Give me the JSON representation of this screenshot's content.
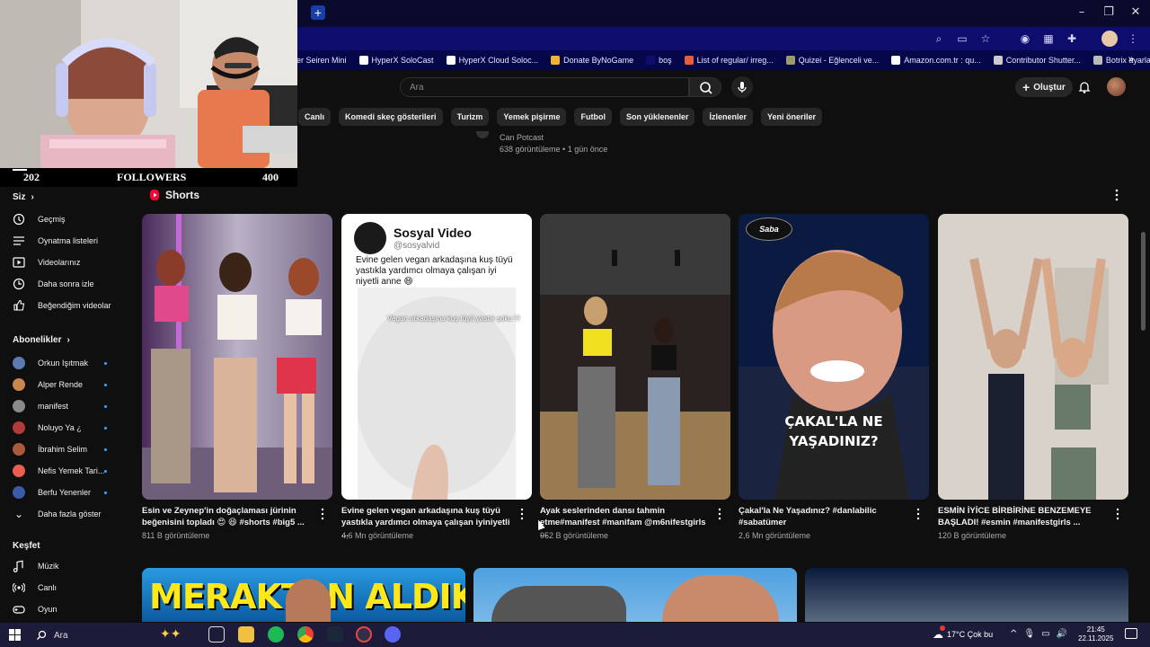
{
  "browser": {
    "bookmarks": [
      {
        "label": "er Seiren Mini",
        "color": "#7a7ab8"
      },
      {
        "label": "HyperX SoloCast",
        "color": "#ffffff"
      },
      {
        "label": "HyperX Cloud Soloc...",
        "color": "#ffffff"
      },
      {
        "label": "Donate ByNoGame",
        "color": "#f2b233"
      },
      {
        "label": "boş",
        "color": "#0d0d6e"
      },
      {
        "label": "List of regular/ irreg...",
        "color": "#e65f3a"
      },
      {
        "label": "Quizei - Eğlenceli ve...",
        "color": "#9c9c6b"
      },
      {
        "label": "Amazon.com.tr : qu...",
        "color": "#ffffff"
      },
      {
        "label": "Contributor  Shutter...",
        "color": "#cccccc"
      },
      {
        "label": "Botrix ayarları nasıl...",
        "color": "#bbbbbb"
      }
    ]
  },
  "header": {
    "search_placeholder": "Ara",
    "create_label": "Oluştur"
  },
  "chips": [
    "Canlı",
    "Komedi skeç gösterileri",
    "Turizm",
    "Yemek pişirme",
    "Futbol",
    "Son yüklenenler",
    "İzlenenler",
    "Yeni öneriler"
  ],
  "previous_video": {
    "channel": "Can Potcast",
    "meta": "638 görüntüleme • 1 gün önce"
  },
  "overlay": {
    "left_count": "202",
    "label": "FOLLOWERS",
    "right_count": "400"
  },
  "sidebar": {
    "you_heading": "Siz",
    "you_items": [
      {
        "label": "Geçmiş",
        "icon": "history-icon"
      },
      {
        "label": "Oynatma listeleri",
        "icon": "playlists-icon"
      },
      {
        "label": "Videolarınız",
        "icon": "your-videos-icon"
      },
      {
        "label": "Daha sonra izle",
        "icon": "watch-later-icon"
      },
      {
        "label": "Beğendiğim videolar",
        "icon": "liked-videos-icon"
      }
    ],
    "subs_heading": "Abonelikler",
    "subscriptions": [
      {
        "label": "Orkun Işıtmak",
        "color": "#5b7bb0"
      },
      {
        "label": "Alper Rende",
        "color": "#c9864f"
      },
      {
        "label": "manifest",
        "color": "#8a8a8a"
      },
      {
        "label": "Noluyo Ya ¿",
        "color": "#b03b3b"
      },
      {
        "label": "İbrahim Selim",
        "color": "#a85a3b"
      },
      {
        "label": "Nefis Yemek Tari...",
        "color": "#e85f4f"
      },
      {
        "label": "Berfu Yenenler",
        "color": "#3b5ba8"
      }
    ],
    "show_more": "Daha fazla göster",
    "explore_heading": "Keşfet",
    "explore_items": [
      {
        "label": "Müzik",
        "icon": "music-icon"
      },
      {
        "label": "Canlı",
        "icon": "live-icon"
      },
      {
        "label": "Oyun",
        "icon": "gaming-icon"
      }
    ]
  },
  "shorts": {
    "heading": "Shorts",
    "items": [
      {
        "title": "Esin ve Zeynep'in doğaçlaması jürinin beğenisini topladı 😍 😆 #shorts #big5 ...",
        "views": "811 B görüntüleme"
      },
      {
        "title": "Evine gelen vegan arkadaşına kuş tüyü yastıkla yardımcı olmaya çalışan iyiniyetli ...",
        "views": "4,6 Mn görüntüleme",
        "card_name": "Sosyal Video",
        "card_handle": "@sosyalvid",
        "card_text": "Evine gelen vegan arkadaşına kuş tüyü yastıkla yardımcı olmaya çalışan iyi niyetli anne 😄",
        "card_caption": "Vegan arkadaşına kuş tüyü yastık şoku !!!"
      },
      {
        "title": "Ayak seslerinden dansı tahmin etme#manifest #manifam @m6nifestgirls ...",
        "views": "952 B görüntüleme"
      },
      {
        "title": "Çakal'la Ne Yaşadınız? #danlabilic #sabatümer",
        "views": "2,6 Mn görüntüleme",
        "overlay_text": "ÇAKAL'LA NE YAŞADINIZ?",
        "logo": "Saba"
      },
      {
        "title": "ESMİN İYİCE BİRBİRİNE BENZEMEYE BAŞLADI! #esmin #manifestgirls ...",
        "views": "120 B görüntüleme"
      }
    ]
  },
  "next_row": {
    "thumb1_text": "MERAKTAN ALDIKLARIM"
  },
  "taskbar": {
    "search_label": "Ara",
    "weather": "17°C  Çok bu",
    "time": "21:45",
    "date": "22.11.2025"
  }
}
